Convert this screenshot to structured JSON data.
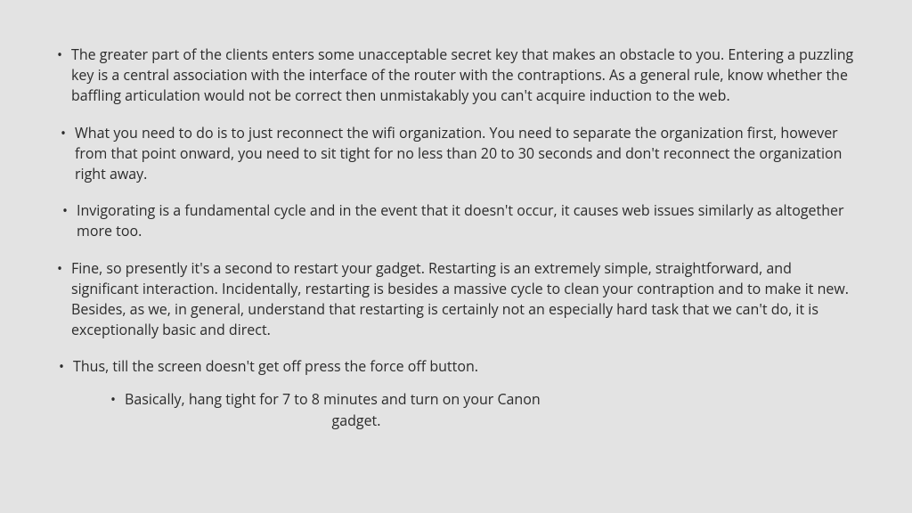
{
  "bullets": [
    "The greater part of the clients enters some unacceptable secret key that makes an obstacle to you. Entering a puzzling key is a central association with the interface of the router with the contraptions. As a general rule, know whether the baffling articulation would not be correct then unmistakably you can't acquire induction to the web.",
    "What you need to do is to just reconnect the wifi organization. You need to separate the organization first, however from that point onward, you need to sit tight for no less than 20 to 30 seconds and don't reconnect the organization right away.",
    "Invigorating is a fundamental cycle and in the event that it doesn't occur, it causes web issues similarly as altogether more too.",
    "Fine, so presently it's a second to restart your gadget. Restarting is an extremely simple, straightforward, and significant interaction. Incidentally, restarting is besides a massive cycle to clean your contraption and to make it new. Besides, as we, in general, understand that restarting is certainly not an especially hard task that we can't do, it is exceptionally basic and direct.",
    "Thus, till the screen doesn't get off press the force off button."
  ],
  "sub_bullet": {
    "line1": "Basically, hang tight for 7 to 8 minutes and turn on your Canon",
    "line2": "gadget."
  }
}
